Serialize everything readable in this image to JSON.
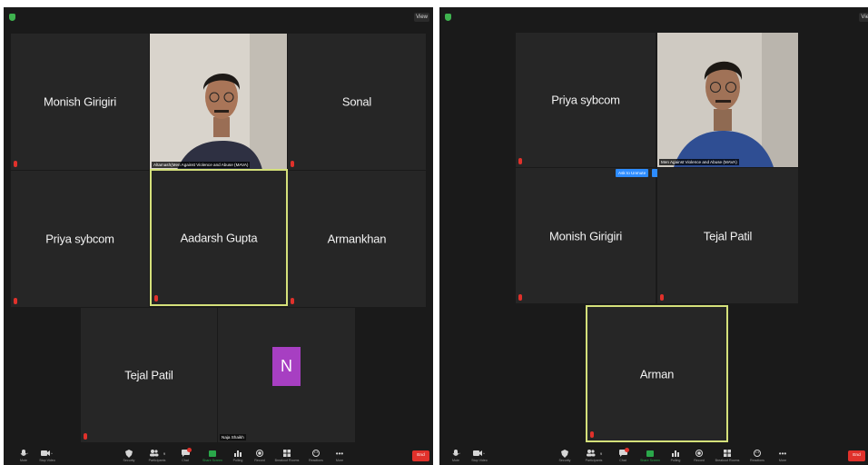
{
  "left_window": {
    "view_label": "View",
    "tiles": [
      {
        "name": "Monish Girigiri"
      },
      {
        "name": "",
        "caption": "Altamash(Men Against Violence and Abuse (MAVA)"
      },
      {
        "name": "Sonal"
      },
      {
        "name": "Priya sybcom"
      },
      {
        "name": "Aadarsh Gupta"
      },
      {
        "name": "Armankhan"
      },
      {
        "name": "Tejal Patil"
      },
      {
        "name": "Naja Shaikh",
        "avatar_letter": "N"
      }
    ]
  },
  "right_window": {
    "view_label": "Vie",
    "tiles": [
      {
        "name": "Priya sybcom"
      },
      {
        "name": "",
        "caption": "Men Against Violence and Abuse (MAVA)"
      },
      {
        "name": "Monish Girigiri"
      },
      {
        "name": "Tejal Patil"
      },
      {
        "name": "Arman"
      }
    ],
    "ask_to_unmute": "Ask to Unmute"
  },
  "toolbar": {
    "mute": "Mute",
    "video": "Stop Video",
    "security": "Security",
    "participants": "Participants",
    "participants_count": "9",
    "chat": "Chat",
    "share": "Share Screen",
    "polling": "Polling",
    "record": "Record",
    "breakout": "Breakout Rooms",
    "reactions": "Reactions",
    "more": "More",
    "end": "End"
  },
  "colors": {
    "active_speaker_border": "#d4e07a",
    "end_button": "#e0312b",
    "avatar_bg": "#a73fc2",
    "ask_to_unmute": "#2d8cff"
  },
  "icons": {
    "shield": "shield-icon",
    "mic": "mic-icon",
    "video": "video-camera-icon",
    "security": "shield-icon",
    "participants": "people-icon",
    "chat": "chat-bubble-icon",
    "share": "share-screen-icon",
    "polling": "bar-chart-icon",
    "record": "record-icon",
    "breakout": "grid-icon",
    "reactions": "emoji-icon",
    "more": "ellipsis-icon"
  }
}
